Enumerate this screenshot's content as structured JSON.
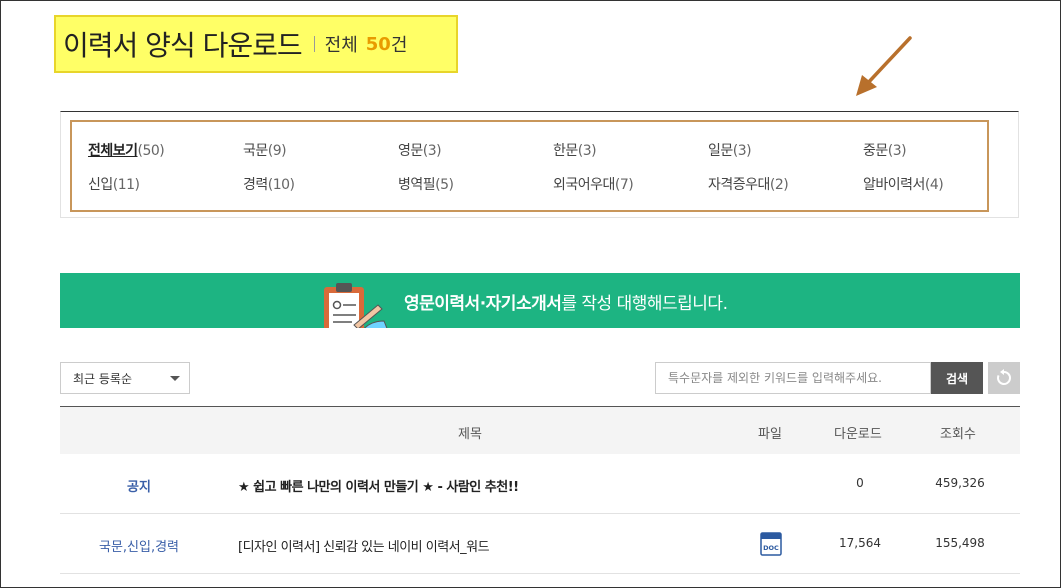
{
  "header": {
    "title": "이력서 양식 다운로드",
    "total_label": "전체",
    "total_count": "50",
    "total_unit": "건"
  },
  "categories": [
    {
      "name": "전체보기",
      "count": "(50)",
      "active": true
    },
    {
      "name": "국문",
      "count": "(9)"
    },
    {
      "name": "영문",
      "count": "(3)"
    },
    {
      "name": "한문",
      "count": "(3)"
    },
    {
      "name": "일문",
      "count": "(3)"
    },
    {
      "name": "중문",
      "count": "(3)"
    },
    {
      "name": "신입",
      "count": "(11)"
    },
    {
      "name": "경력",
      "count": "(10)"
    },
    {
      "name": "병역필",
      "count": "(5)"
    },
    {
      "name": "외국어우대",
      "count": "(7)"
    },
    {
      "name": "자격증우대",
      "count": "(2)"
    },
    {
      "name": "알바이력서",
      "count": "(4)"
    }
  ],
  "banner": {
    "highlight": "영문이력서·자기소개서",
    "text": "를 작성 대행해드립니다.",
    "color": "#1db482"
  },
  "toolbar": {
    "sort_value": "최근 등록순",
    "search_placeholder": "특수문자를 제외한 키워드를 입력해주세요.",
    "search_button": "검색"
  },
  "table": {
    "columns": [
      "제목",
      "파일",
      "다운로드",
      "조회수"
    ],
    "rows": [
      {
        "category": "공지",
        "title": "★ 쉽고 빠른 나만의 이력서 만들기 ★ - 사람인 추천!!",
        "file": "",
        "downloads": "0",
        "views": "459,326",
        "notice": true
      },
      {
        "category": "국문,신입,경력",
        "title": "[디자인 이력서] 신뢰감 있는 네이비 이력서_워드",
        "file": "DOC",
        "downloads": "17,564",
        "views": "155,498",
        "notice": false
      }
    ]
  }
}
